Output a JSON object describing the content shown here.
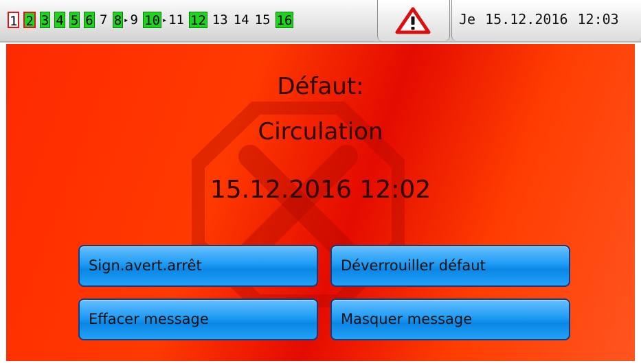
{
  "status_bar": {
    "outputs": [
      {
        "label": "1",
        "state": "alert-off"
      },
      {
        "label": "2",
        "state": "alert-on"
      },
      {
        "label": "3",
        "state": "on"
      },
      {
        "label": "4",
        "state": "on"
      },
      {
        "label": "5",
        "state": "on"
      },
      {
        "label": "6",
        "state": "on"
      },
      {
        "label": "7",
        "state": "off"
      },
      {
        "label": "8",
        "state": "on"
      },
      {
        "label": "9",
        "state": "off"
      },
      {
        "label": "10",
        "state": "on"
      },
      {
        "label": "11",
        "state": "off"
      },
      {
        "label": "12",
        "state": "on"
      },
      {
        "label": "13",
        "state": "off"
      },
      {
        "label": "14",
        "state": "off"
      },
      {
        "label": "15",
        "state": "off"
      },
      {
        "label": "16",
        "state": "on"
      }
    ],
    "warning_icon": "warning-triangle-icon",
    "day": "Je",
    "date": "15.12.2016",
    "time": "12:03"
  },
  "alarm": {
    "title": "Défaut:",
    "name": "Circulation",
    "timestamp": "15.12.2016 12:02",
    "background_icon": "stop-octagon-x-icon"
  },
  "buttons": {
    "silence": "Sign.avert.arrêt",
    "unlock": "Déverrouiller défaut",
    "delete": "Effacer message",
    "hide": "Masquer message"
  },
  "colors": {
    "output_on": "#1ed41e",
    "alert_border": "#e01616",
    "alarm_background": "#ff3000",
    "button": "#1e9cf4"
  }
}
